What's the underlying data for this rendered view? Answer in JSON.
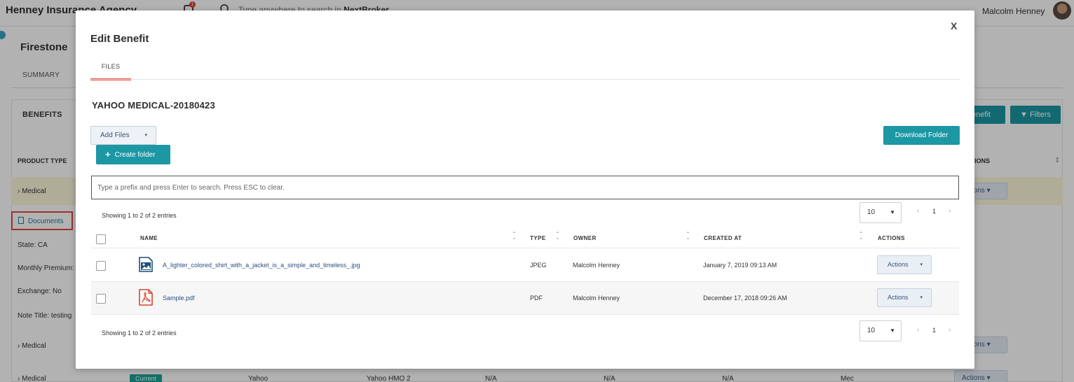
{
  "background": {
    "agency_name": "Henney Insurance Agency",
    "notification_count": "1",
    "top_search_placeholder": "Type anywhere to search in ",
    "top_search_brand": "NextBroker",
    "user_name": "Malcolm Henney",
    "client_name": "Firestone",
    "summary_tab": "SUMMARY",
    "benefits_title": "BENEFITS",
    "add_benefit_label": "enefit",
    "filters_label": "Filters",
    "product_type_header": "PRODUCT TYPE",
    "actions_header": "IONS",
    "rows": [
      {
        "label": "Medical"
      },
      {
        "label": "Medical"
      },
      {
        "label": "Medical"
      }
    ],
    "documents_link": "Documents",
    "details": [
      {
        "label": "State:",
        "value": "CA"
      },
      {
        "label": "Monthly Premium:",
        "value": ""
      },
      {
        "label": "Exchange:",
        "value": "No"
      },
      {
        "label": "Note Title:",
        "value": "testing"
      }
    ],
    "last_row": {
      "badge": "Current",
      "carrier": "Yahoo",
      "plan": "Yahoo HMO 2",
      "col3": "N/A",
      "col4": "N/A",
      "col5": "N/A",
      "col6": "Mec"
    },
    "actions_label": "Actions"
  },
  "modal": {
    "title": "Edit Benefit",
    "close_label": "X",
    "tab_files": "FILES",
    "benefit_name": "YAHOO MEDICAL-20180423",
    "add_files_label": "Add Files",
    "create_folder_label": "Create folder",
    "download_folder_label": "Download Folder",
    "search_placeholder": "Type a prefix and press Enter to search. Press ESC to clear.",
    "showing_text": "Showing 1 to 2 of 2 entries",
    "page_size": "10",
    "current_page": "1",
    "columns": [
      "NAME",
      "TYPE",
      "OWNER",
      "CREATED AT",
      "ACTIONS"
    ],
    "files": [
      {
        "name": "A_lighter_colored_shirt_with_a_jacket_is_a_simple_and_timeless_.jpg",
        "type": "JPEG",
        "owner": "Malcolm Henney",
        "created_at": "January 7, 2019 09:13 AM",
        "icon": "image-file-icon",
        "actions": "Actions"
      },
      {
        "name": "Sample.pdf",
        "type": "PDF",
        "owner": "Malcolm Henney",
        "created_at": "December 17, 2018 09:26 AM",
        "icon": "pdf-file-icon",
        "actions": "Actions"
      }
    ],
    "accent_color": "#1c97a4",
    "tab_underline_color": "#e7523f"
  }
}
